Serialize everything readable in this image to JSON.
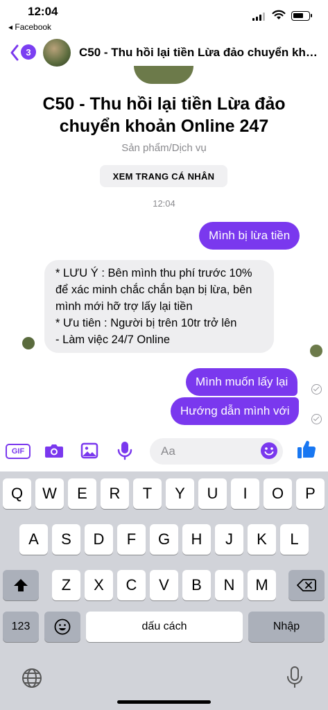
{
  "status_bar": {
    "time": "12:04",
    "back_app": "◂ Facebook"
  },
  "header": {
    "unread_count": "3",
    "title": "C50 - Thu hồi lại tiền Lừa đảo chuyển khoản Online 247"
  },
  "profile": {
    "name": "C50 - Thu hồi lại tiền Lừa đảo chuyển khoản Online 247",
    "category": "Sản phẩm/Dịch vụ",
    "view_profile_label": "XEM TRANG CÁ NHÂN"
  },
  "conversation": {
    "timestamp": "12:04",
    "messages": [
      {
        "from": "me",
        "text": "Mình bị lừa tiền"
      },
      {
        "from": "page",
        "text": "* LƯU Ý : Bên mình thu phí trước 10% để xác minh chắc chắn bạn bị lừa, bên mình mới hỡ trợ lấy lại tiền\n* Ưu tiên : Người bị trên 10tr trở lên\n- Làm việc 24/7 Online"
      },
      {
        "from": "me",
        "text": "Mình muốn lấy lại"
      },
      {
        "from": "me",
        "text": "Hướng dẫn mình với"
      }
    ]
  },
  "composer": {
    "placeholder": "Aa",
    "gif_label": "GIF"
  },
  "keyboard": {
    "row1": [
      "Q",
      "W",
      "E",
      "R",
      "T",
      "Y",
      "U",
      "I",
      "O",
      "P"
    ],
    "row2": [
      "A",
      "S",
      "D",
      "F",
      "G",
      "H",
      "J",
      "K",
      "L"
    ],
    "row3": [
      "Z",
      "X",
      "C",
      "V",
      "B",
      "N",
      "M"
    ],
    "numbers_label": "123",
    "space_label": "dấu cách",
    "return_label": "Nhập"
  },
  "colors": {
    "accent": "#7a38ee",
    "like_blue": "#1877f2",
    "keyboard_bg": "#d1d3d9"
  }
}
